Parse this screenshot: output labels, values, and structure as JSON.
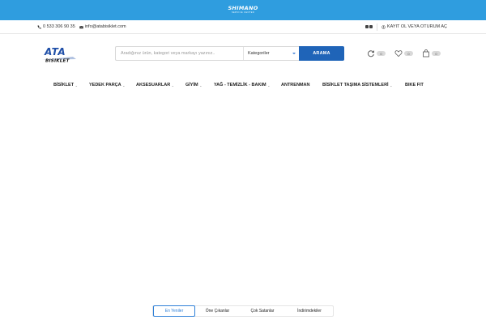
{
  "promo": {
    "brand": "SHIMANO",
    "subtitle": "SERVICE CENTER",
    "background_color": "#2f9ddf"
  },
  "topbar": {
    "phone_icon": "phone-icon",
    "phone": "0 533 306 90 35",
    "email_icon": "mail-icon",
    "email": "info@atabisiklet.com",
    "social_icons": [
      "facebook-icon",
      "instagram-icon"
    ],
    "account_icon": "user-icon",
    "account_text": "KAYIT OL VEYA OTURUM AÇ"
  },
  "header": {
    "logo_text_top": "ATA",
    "logo_text_bottom": "BISIKLET",
    "logo_color": "#1f4fa8",
    "search": {
      "placeholder": "Aradığınız ürün, kategori veya markayı yazınız..",
      "category_label": "Kategoriler",
      "button_label": "ARAMA",
      "button_color": "#1f64b8"
    },
    "compare": {
      "icon": "refresh-icon",
      "count": "0"
    },
    "wishlist": {
      "icon": "heart-icon",
      "count": "0"
    },
    "cart": {
      "icon": "shopping-bag-icon",
      "count": "0"
    }
  },
  "nav": {
    "items": [
      {
        "label": "BİSİKLET",
        "has_dropdown": true
      },
      {
        "label": "YEDEK PARÇA",
        "has_dropdown": true
      },
      {
        "label": "AKSESUARLAR",
        "has_dropdown": true
      },
      {
        "label": "GİYİM",
        "has_dropdown": true
      },
      {
        "label": "YAĞ - TEMİZLİK - BAKIM",
        "has_dropdown": true
      },
      {
        "label": "ANTRENMAN",
        "has_dropdown": false
      },
      {
        "label": "BİSİKLET TAŞIMA SİSTEMLERİ",
        "has_dropdown": true
      },
      {
        "label": "BIKE FIT",
        "has_dropdown": false
      }
    ]
  },
  "product_tabs": {
    "active_color": "#2f80d8",
    "items": [
      {
        "label": "En Yeniler",
        "active": true
      },
      {
        "label": "Öne Çıkanlar",
        "active": false
      },
      {
        "label": "Çok Satanlar",
        "active": false
      },
      {
        "label": "İndirimdekiler",
        "active": false
      }
    ]
  }
}
